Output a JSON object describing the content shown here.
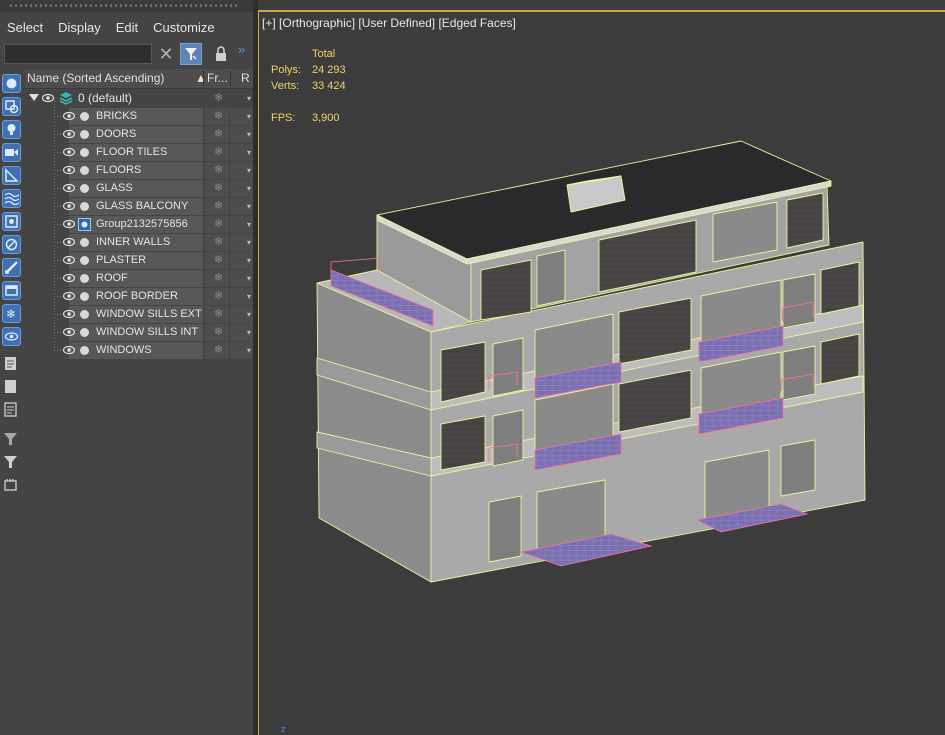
{
  "menubar": {
    "items": [
      "Select",
      "Display",
      "Edit",
      "Customize"
    ]
  },
  "search": {
    "placeholder": "",
    "value": ""
  },
  "tree": {
    "columns": {
      "name": "Name (Sorted Ascending)",
      "frozen": "Fr...",
      "render": "R"
    },
    "root_layer": "0 (default)",
    "items": [
      "BRICKS",
      "DOORS",
      "FLOOR TILES",
      "FLOORS",
      "GLASS",
      "GLASS BALCONY",
      "Group2132575856",
      "INNER WALLS",
      "PLASTER",
      "ROOF",
      "ROOF BORDER",
      "WINDOW SILLS EXT",
      "WINDOW SILLS INT",
      "WINDOWS"
    ]
  },
  "viewport": {
    "labels": [
      "[+]",
      "[Orthographic]",
      "[User Defined]",
      "[Edged Faces]"
    ],
    "stats": {
      "total_header": "Total",
      "polys_label": "Polys:",
      "polys_value": "24 293",
      "verts_label": "Verts:",
      "verts_value": "33 424",
      "fps_label": "FPS:",
      "fps_value": "3,900"
    },
    "accent_color": "#c8a83c",
    "stats_color": "#f0d26a"
  },
  "icons": {
    "left_column": [
      "sphere-icon",
      "shapes-icon",
      "light-icon",
      "camera-icon",
      "helper-icon",
      "spacewarp-icon",
      "group-icon",
      "xref-icon",
      "bone-icon",
      "container-icon",
      "frozen-icon",
      "hidden-icon",
      "list-icon",
      "document-icon",
      "layer-list-icon",
      "filter-settings-icon",
      "filter-icon",
      "selection-set-icon"
    ]
  }
}
